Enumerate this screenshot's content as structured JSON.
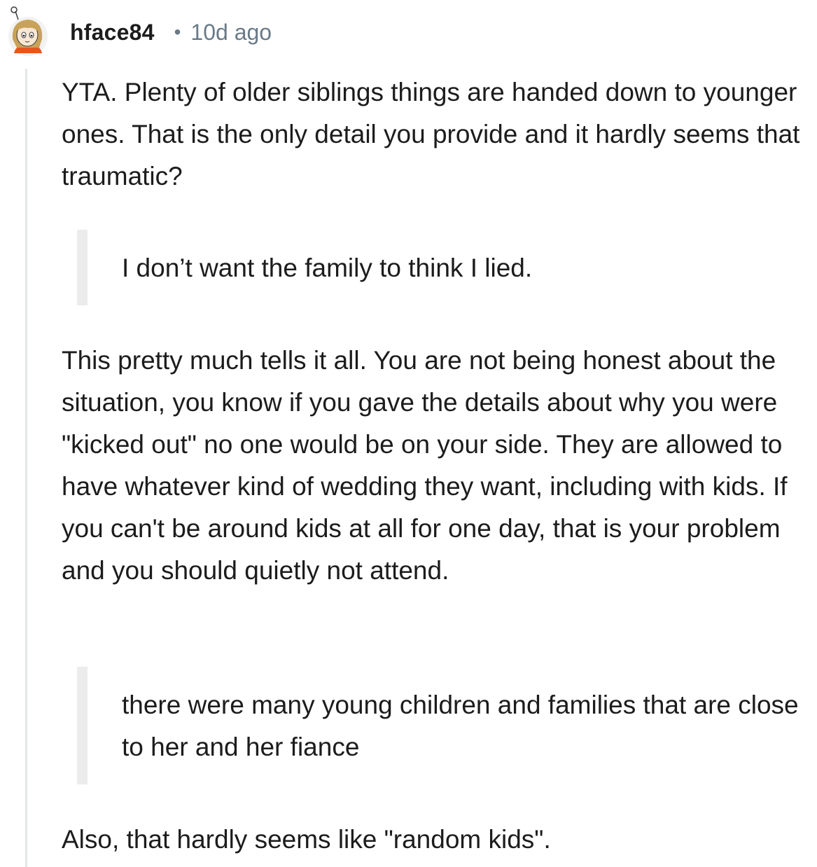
{
  "comment": {
    "username": "hface84",
    "separator": "•",
    "timestamp": "10d ago",
    "paragraph_1": "YTA. Plenty of older siblings things are handed down to younger ones. That is the only detail you provide and it hardly seems that traumatic?",
    "quote_1": "I don’t want the family to think I lied.",
    "paragraph_2": "This pretty much tells it all. You are not being honest about the situation, you know if you gave the details about why you were \"kicked out\" no one would be on your side. They are allowed to have whatever kind of wedding they want, including with kids. If you can't be around kids at all for one day, that is your problem and you should quietly not attend.",
    "quote_2": "there were many young children and families that are close to her and her fiance",
    "paragraph_3": "Also, that hardly seems like \"random kids\"."
  },
  "colors": {
    "text": "#1c1c1c",
    "meta": "#6a7a86",
    "thread_line": "#e4e6e8",
    "quote_bar": "#ececec",
    "avatar_shirt": "#e8561f",
    "avatar_hair": "#c9a25a"
  },
  "icons": {
    "avatar": "snoo-avatar-icon"
  }
}
